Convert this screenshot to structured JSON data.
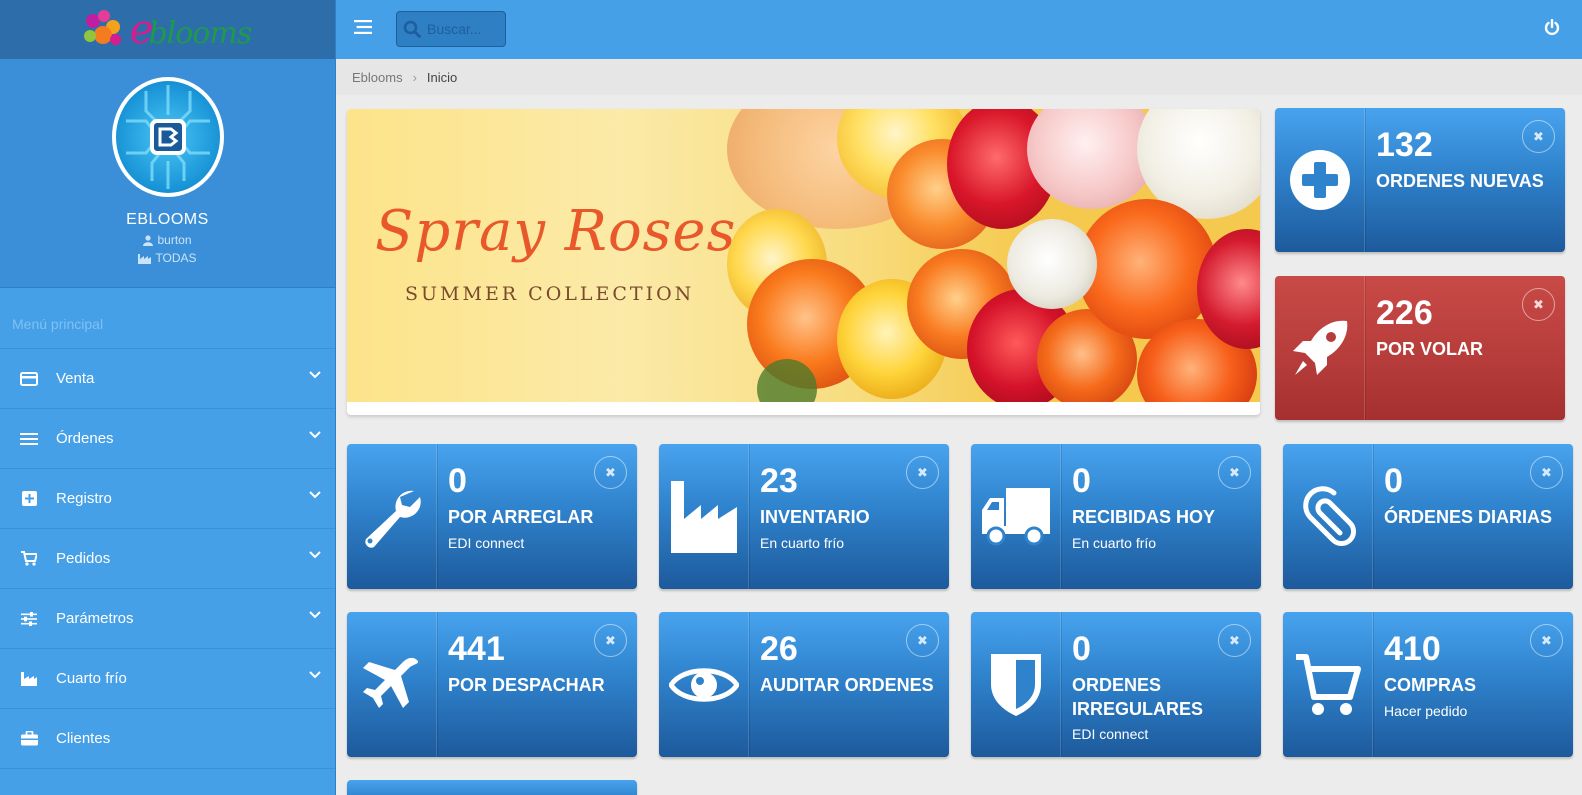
{
  "brand": {
    "logo_text": "blooms",
    "logo_initial": "e"
  },
  "profile": {
    "company": "EBLOOMS",
    "user": "burton",
    "store": "TODAS"
  },
  "menu": {
    "heading": "Menú principal",
    "items": [
      {
        "label": "Venta",
        "icon": "credit-card-icon"
      },
      {
        "label": "Órdenes",
        "icon": "list-icon"
      },
      {
        "label": "Registro",
        "icon": "plus-square-icon"
      },
      {
        "label": "Pedidos",
        "icon": "cart-icon"
      },
      {
        "label": "Parámetros",
        "icon": "sliders-icon"
      },
      {
        "label": "Cuarto frío",
        "icon": "industry-icon"
      },
      {
        "label": "Clientes",
        "icon": "briefcase-icon"
      }
    ]
  },
  "topbar": {
    "search_placeholder": "Buscar..."
  },
  "breadcrumb": {
    "root": "Eblooms",
    "current": "Inicio"
  },
  "banner": {
    "title": "Spray Roses",
    "subtitle": "SUMMER COLLECTION"
  },
  "cards": {
    "ordenes_nuevas": {
      "value": "132",
      "label": "ORDENES NUEVAS"
    },
    "por_volar": {
      "value": "226",
      "label": "POR VOLAR"
    },
    "por_arreglar": {
      "value": "0",
      "label": "POR ARREGLAR",
      "sub": "EDI connect"
    },
    "inventario": {
      "value": "23",
      "label": "INVENTARIO",
      "sub": "En cuarto frío"
    },
    "recibidas_hoy": {
      "value": "0",
      "label": "RECIBIDAS HOY",
      "sub": "En cuarto frío"
    },
    "ordenes_diarias": {
      "value": "0",
      "label": "ÓRDENES DIARIAS"
    },
    "por_despachar": {
      "value": "441",
      "label": "POR DESPACHAR"
    },
    "auditar_ordenes": {
      "value": "26",
      "label": "AUDITAR ORDENES"
    },
    "ordenes_irregulares": {
      "value": "0",
      "label": "ORDENES IRREGULARES",
      "sub": "EDI connect"
    },
    "compras": {
      "value": "410",
      "label": "COMPRAS",
      "sub": "Hacer pedido"
    }
  },
  "colors": {
    "primary": "#45a0e8",
    "sidebar_dark": "#2d6eaa",
    "danger": "#b53c3a"
  }
}
